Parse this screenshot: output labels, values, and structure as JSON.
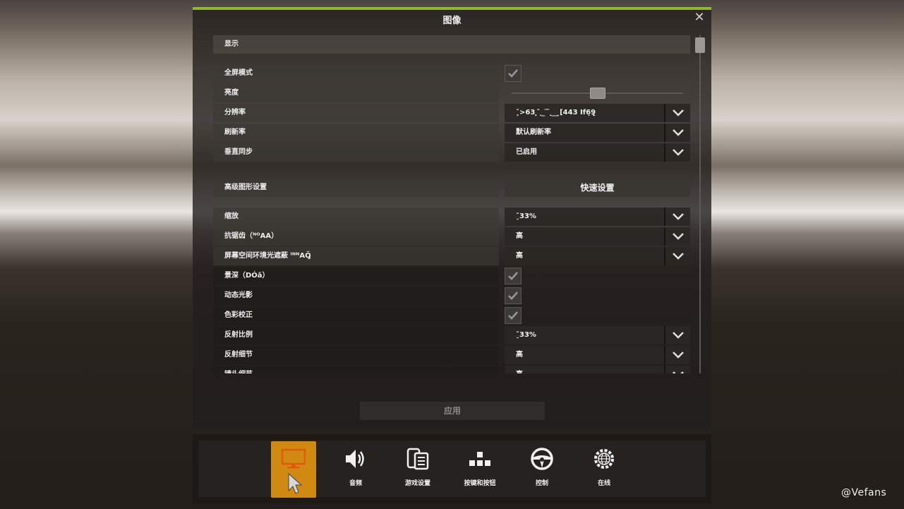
{
  "dialog": {
    "title": "图像",
    "close_glyph": "✕",
    "apply_label": "应用"
  },
  "sections": {
    "display": "显示",
    "advanced": "高级图形设置",
    "quick_setup": "快速设置"
  },
  "settings": {
    "fullscreen": {
      "label": "全屏模式",
      "checked": true
    },
    "brightness": {
      "label": "亮度",
      "level": 0.5
    },
    "resolution": {
      "label": "分辨率",
      "value": "ˇ̥>63 ̥ ̂ ̣ ̲ ̃ ̃ ̣ ̲ ̲ ̬[443 If6̧9̢"
    },
    "refresh_rate": {
      "label": "刷新率",
      "value": "默认刷新率"
    },
    "vsync": {
      "label": "垂直同步",
      "value": "已启用"
    },
    "scale": {
      "label": "缩放",
      "value": "ˇ̮33%"
    },
    "antialiasing": {
      "label": "抗锯齿（ᴺᴼAA）",
      "value": "高"
    },
    "ssao": {
      "label": "屏幕空间环境光遮蔽 ᴵᴺᴺAŐ̡",
      "value": "高"
    },
    "dof": {
      "label": "景深（DÓǎ）",
      "checked": true
    },
    "dynamic_light": {
      "label": "动态光影",
      "checked": true
    },
    "color_correction": {
      "label": "色彩校正",
      "checked": true
    },
    "reflection_scale": {
      "label": "反射比例",
      "value": "ˇ̮33%"
    },
    "reflection_detail": {
      "label": "反射细节",
      "value": "高"
    },
    "mirror_detail": {
      "label": "镜头细节",
      "value": "高"
    }
  },
  "scroll_position": 0.0,
  "nav": {
    "items": [
      {
        "label": "",
        "icon": "monitor-icon",
        "active": true
      },
      {
        "label": "音频",
        "icon": "speaker-icon"
      },
      {
        "label": "游戏设置",
        "icon": "game-settings-icon"
      },
      {
        "label": "按键和按钮",
        "icon": "keys-icon"
      },
      {
        "label": "控制",
        "icon": "steering-wheel-icon"
      },
      {
        "label": "在线",
        "icon": "gear-globe-icon"
      }
    ]
  },
  "watermark": "@Vefans",
  "colors": {
    "accent": "#8fb82e",
    "active_tab": "#d08a11"
  }
}
